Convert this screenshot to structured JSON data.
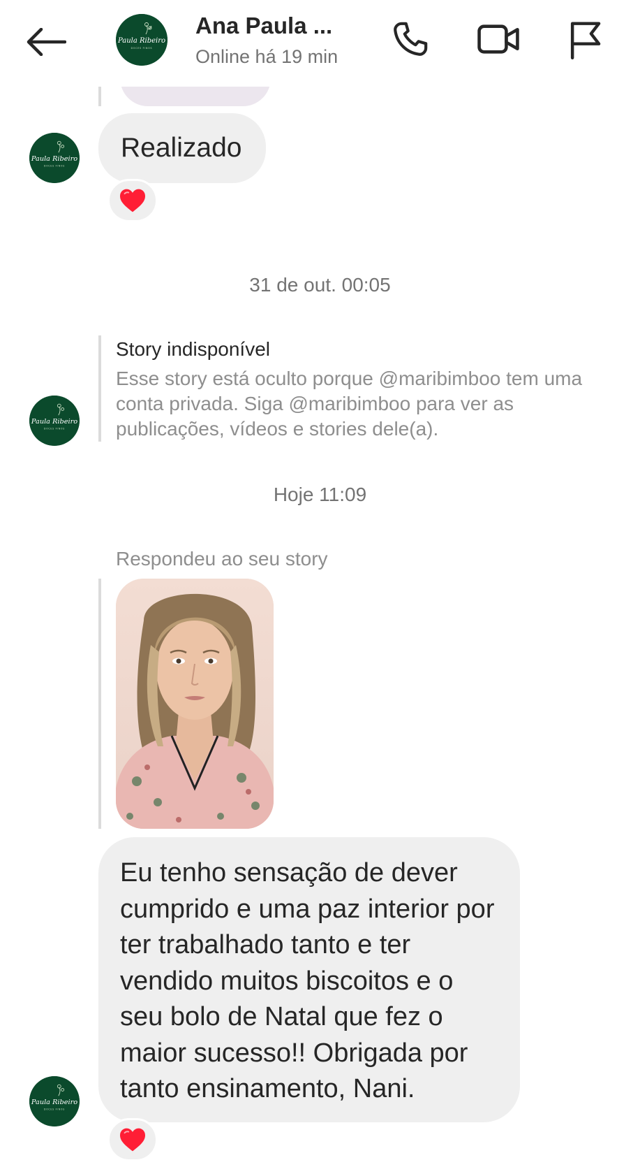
{
  "header": {
    "contact_name": "Ana Paula ...",
    "status": "Online há 19 min",
    "icons": {
      "back": "arrow-left-icon",
      "call": "phone-icon",
      "video": "video-camera-icon",
      "report": "flag-icon"
    }
  },
  "messages": {
    "realizado": "Realizado",
    "reaction_1": "❤️",
    "timestamp_1": "31 de out. 00:05",
    "story_unavailable": {
      "title": "Story indisponível",
      "body": "Esse story está oculto porque @maribimboo tem uma conta privada. Siga @maribimboo para ver as publicações, vídeos e stories dele(a)."
    },
    "timestamp_2": "Hoje 11:09",
    "replied_label": "Respondeu ao seu story",
    "reply_text": "Eu tenho sensação de dever cumprido e uma paz interior por ter trabalhado tanto e ter vendido muitos biscoitos e o seu bolo de Natal que fez o maior sucesso!! Obrigada por tanto ensinamento, Nani.",
    "reaction_2": "❤️"
  },
  "avatar": {
    "brand_name": "Paula Ribeiro",
    "brand_sub": "DOCES FINOS",
    "bg_color": "#0b4a2c"
  },
  "colors": {
    "bubble": "#efefef",
    "secondary_text": "#8e8e8e",
    "heart": "#ff1e35"
  }
}
